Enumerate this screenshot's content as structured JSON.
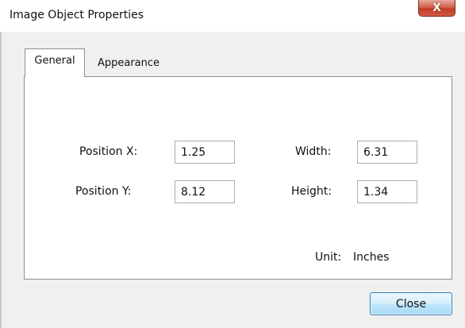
{
  "window": {
    "title": "Image Object Properties",
    "close_glyph": "X",
    "close_icon": "close-icon"
  },
  "tabs": [
    {
      "label": "General",
      "selected": true
    },
    {
      "label": "Appearance",
      "selected": false
    }
  ],
  "general": {
    "position_x_label": "Position X:",
    "position_x_value": "1.25",
    "position_y_label": "Position Y:",
    "position_y_value": "8.12",
    "width_label": "Width:",
    "width_value": "6.31",
    "height_label": "Height:",
    "height_value": "1.34",
    "unit_label": "Unit:",
    "unit_value": "Inches"
  },
  "buttons": {
    "close_label": "Close"
  },
  "colors": {
    "close_button_red": "#c43a25",
    "default_button_border": "#3c7fb1"
  }
}
